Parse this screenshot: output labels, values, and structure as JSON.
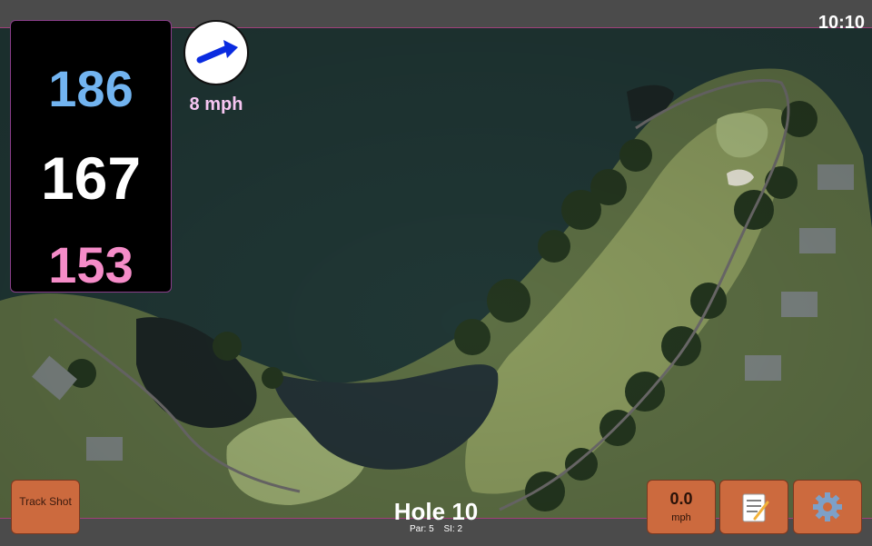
{
  "status": {
    "time": "10:10"
  },
  "distances": {
    "back": "186",
    "middle": "167",
    "front": "153"
  },
  "wind": {
    "speed_label": "8 mph",
    "direction_icon": "wind-arrow-icon",
    "speed_value": "0.0",
    "speed_unit": "mph"
  },
  "hole": {
    "title": "Hole 10",
    "par": "Par: 5",
    "si": "SI: 2"
  },
  "buttons": {
    "track_shot": "Track Shot",
    "notes_icon": "notepad-icon",
    "settings_icon": "gear-icon"
  },
  "colors": {
    "accent": "#cc6a3e",
    "back_distance": "#72b4f0",
    "middle_distance": "#ffffff",
    "front_distance": "#f58cc8",
    "wind_label": "#f7c6f2"
  }
}
